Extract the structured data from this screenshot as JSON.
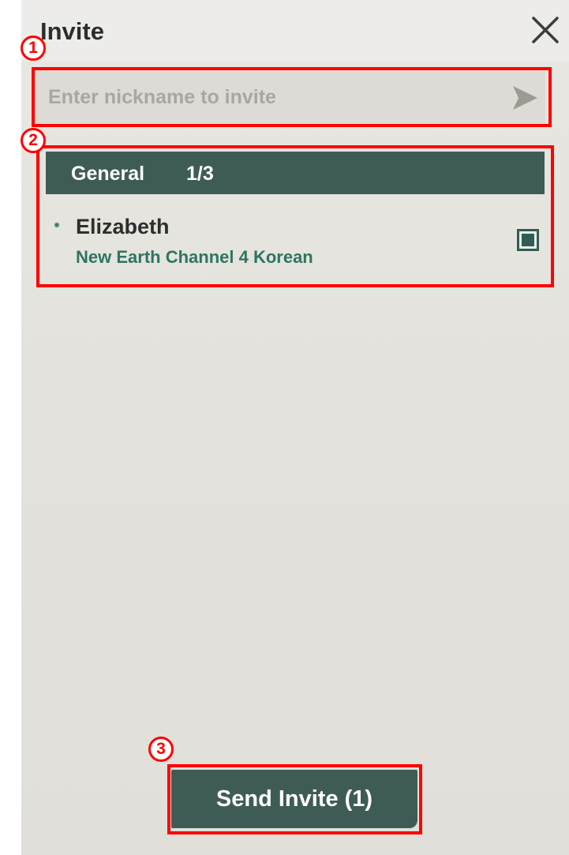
{
  "header": {
    "title": "Invite"
  },
  "search": {
    "placeholder": "Enter nickname to invite",
    "value": ""
  },
  "group": {
    "name": "General",
    "count": "1/3"
  },
  "members": [
    {
      "name": "Elizabeth",
      "channel": "New Earth Channel 4 Korean",
      "online": true,
      "selected": true
    }
  ],
  "footer": {
    "send_label": "Send Invite (1)"
  },
  "annotations": [
    "1",
    "2",
    "3"
  ],
  "icons": {
    "close": "close-icon",
    "send": "send-arrow-icon",
    "status": "online-status-icon",
    "checkbox": "checkbox-checked-icon"
  },
  "colors": {
    "accent": "#3e5c55",
    "channel_text": "#2d7562",
    "annotation": "#ff0000"
  }
}
